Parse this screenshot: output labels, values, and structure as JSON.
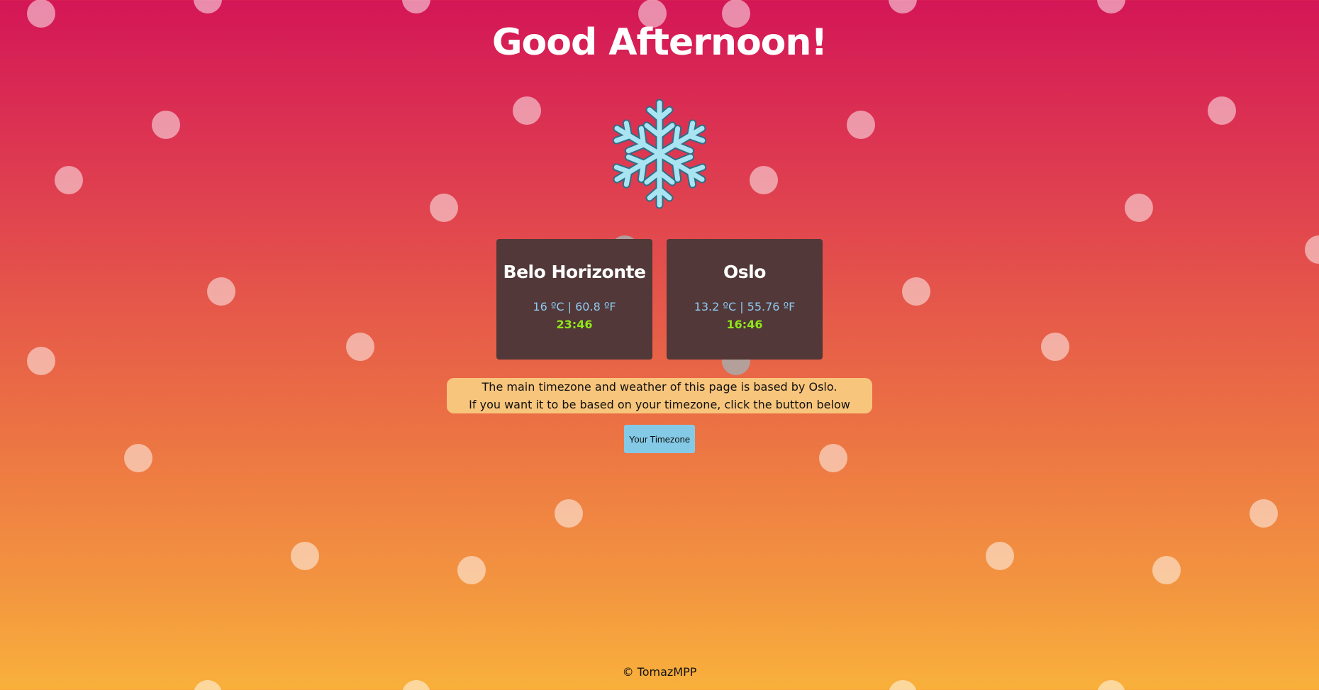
{
  "greeting": "Good Afternoon!",
  "weather_icon": "snowflake-icon",
  "cities": [
    {
      "name": "Belo Horizonte",
      "temp": "16 ºC | 60.8 ºF",
      "time": "23:46"
    },
    {
      "name": "Oslo",
      "temp": "13.2 ºC | 55.76 ºF",
      "time": "16:46"
    }
  ],
  "info": {
    "line1": "The main timezone and weather of this page is based by Oslo.",
    "line2": "If you want it to be based on your timezone, click the button below"
  },
  "button_label": "Your Timezone",
  "footer": "© TomazMPP",
  "colors": {
    "card_bg": "#523838",
    "temp_text": "#8dcaf2",
    "time_text": "#8fe51a",
    "info_bg": "#f8c57c",
    "button_bg": "#84cae6",
    "snowflake": "#a9e4f2"
  }
}
